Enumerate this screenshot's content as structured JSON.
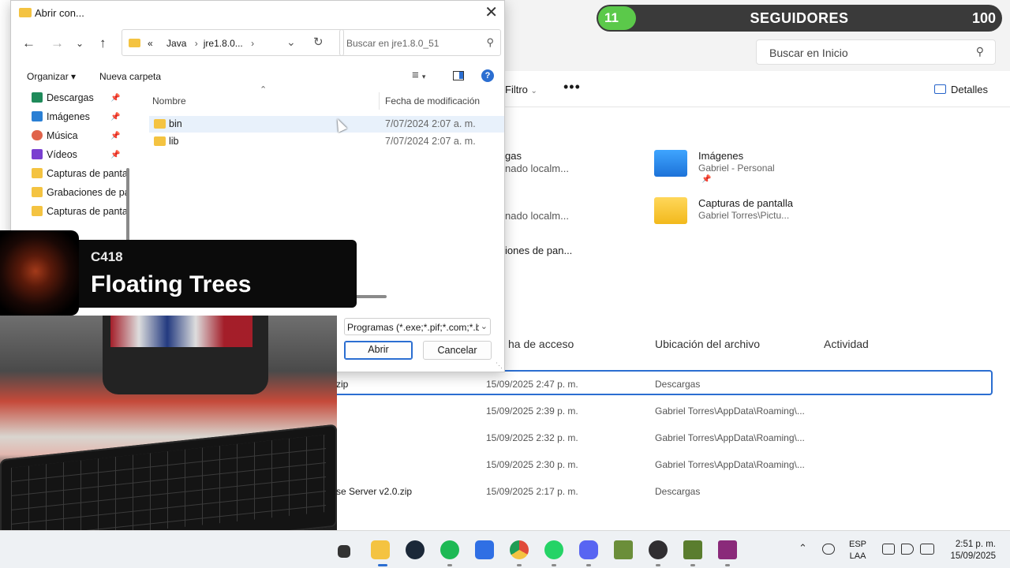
{
  "stream_overlay": {
    "followers_current": "11",
    "followers_label": "SEGUIDORES",
    "followers_goal": "100",
    "now_playing_artist": "C418",
    "now_playing_title": "Floating Trees"
  },
  "explorer": {
    "search_placeholder": "Buscar en Inicio",
    "filter_label": "Filtro",
    "more_label": "•••",
    "details_label": "Detalles",
    "quick_access_fragments": [
      "gas",
      "nado localm...",
      "nado localm...",
      "iones de pan..."
    ],
    "favorites": [
      {
        "name": "Imágenes",
        "sub": "Gabriel - Personal",
        "pinned": true,
        "icon": "pictures-folder-icon"
      },
      {
        "name": "Capturas de pantalla",
        "sub": "Gabriel Torres\\Pictu...",
        "pinned": false,
        "icon": "folder-icon"
      }
    ],
    "recent_columns": [
      "ha de acceso",
      "Ubicación del archivo",
      "Actividad"
    ],
    "recent_rows": [
      {
        "name": "zip",
        "date": "15/09/2025 2:47 p. m.",
        "location": "Descargas",
        "selected": true
      },
      {
        "name": "",
        "date": "15/09/2025 2:39 p. m.",
        "location": "Gabriel Torres\\AppData\\Roaming\\...",
        "selected": false
      },
      {
        "name": "",
        "date": "15/09/2025 2:32 p. m.",
        "location": "Gabriel Torres\\AppData\\Roaming\\...",
        "selected": false
      },
      {
        "name": "",
        "date": "15/09/2025 2:30 p. m.",
        "location": "Gabriel Torres\\AppData\\Roaming\\...",
        "selected": false
      },
      {
        "name": "se Server v2.0.zip",
        "date": "15/09/2025 2:17 p. m.",
        "location": "Descargas",
        "selected": false
      }
    ]
  },
  "dialog": {
    "title": "Abrir con...",
    "address_prefix": "«",
    "breadcrumbs": [
      "Java",
      "jre1.8.0..."
    ],
    "search_placeholder": "Buscar en jre1.8.0_51",
    "organize_label": "Organizar ▾",
    "new_folder_label": "Nueva carpeta",
    "help_label": "?",
    "sidebar": [
      {
        "label": "Descargas",
        "icon": "download-icon",
        "pinned": true,
        "color": "#1f8a5a"
      },
      {
        "label": "Imágenes",
        "icon": "pictures-icon",
        "pinned": true,
        "color": "#2a7fd4"
      },
      {
        "label": "Música",
        "icon": "music-icon",
        "pinned": true,
        "color": "#e0634a"
      },
      {
        "label": "Vídeos",
        "icon": "videos-icon",
        "pinned": true,
        "color": "#7a3fd0"
      },
      {
        "label": "Capturas de pantalla",
        "icon": "folder-icon",
        "pinned": false,
        "color": "#f4c341"
      },
      {
        "label": "Grabaciones de pantalla",
        "icon": "folder-icon",
        "pinned": false,
        "color": "#f4c341"
      },
      {
        "label": "Capturas de pantalla",
        "icon": "folder-icon",
        "pinned": false,
        "color": "#f4c341"
      }
    ],
    "columns": {
      "name": "Nombre",
      "date": "Fecha de modificación"
    },
    "files": [
      {
        "name": "bin",
        "date": "7/07/2024 2:07 a. m."
      },
      {
        "name": "lib",
        "date": "7/07/2024 2:07 a. m."
      }
    ],
    "file_type_filter": "Programas (*.exe;*.pif;*.com;*.b",
    "open_label": "Abrir",
    "cancel_label": "Cancelar"
  },
  "taskbar": {
    "apps": [
      {
        "name": "file-explorer",
        "color": "#f4c341",
        "active": true
      },
      {
        "name": "steam",
        "color": "#1b2838",
        "active": false
      },
      {
        "name": "spotify",
        "color": "#1db954",
        "active": false
      },
      {
        "name": "roblox",
        "color": "#2f6fe4",
        "active": false
      },
      {
        "name": "chrome",
        "color": "#e04a3a",
        "active": false
      },
      {
        "name": "whatsapp",
        "color": "#25d366",
        "active": false
      },
      {
        "name": "discord",
        "color": "#5865f2",
        "active": false
      },
      {
        "name": "minecraft",
        "color": "#6b8e3a",
        "active": false
      },
      {
        "name": "obs",
        "color": "#302e31",
        "active": false
      },
      {
        "name": "minecraft-2",
        "color": "#5a7d2e",
        "active": false
      },
      {
        "name": "winrar",
        "color": "#8a2a7a",
        "active": false
      }
    ],
    "language_line1": "ESP",
    "language_line2": "LAA",
    "time": "2:51 p. m.",
    "date": "15/09/2025"
  }
}
